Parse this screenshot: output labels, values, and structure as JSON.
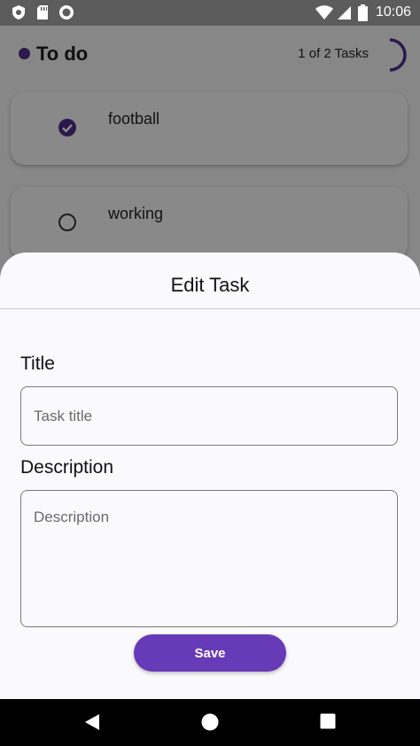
{
  "status_bar": {
    "time": "10:06",
    "icons_left": [
      "shield-icon",
      "sd-card-icon",
      "circle-notification-icon"
    ],
    "icons_right": [
      "wifi-icon",
      "cellular-signal-icon",
      "battery-icon"
    ]
  },
  "header": {
    "title": "To do",
    "count_text": "1 of 2 Tasks",
    "progress_fraction": 0.5,
    "accent_color": "#4a2b83"
  },
  "tasks": [
    {
      "label": "football",
      "completed": true
    },
    {
      "label": "working",
      "completed": false
    }
  ],
  "sheet": {
    "title": "Edit Task",
    "title_field": {
      "label": "Title",
      "placeholder": "Task title",
      "value": ""
    },
    "description_field": {
      "label": "Description",
      "placeholder": "Description",
      "value": ""
    },
    "save_label": "Save",
    "button_color": "#673ab7"
  },
  "nav_bar": {
    "buttons": [
      "back-icon",
      "home-icon",
      "recents-icon"
    ]
  }
}
